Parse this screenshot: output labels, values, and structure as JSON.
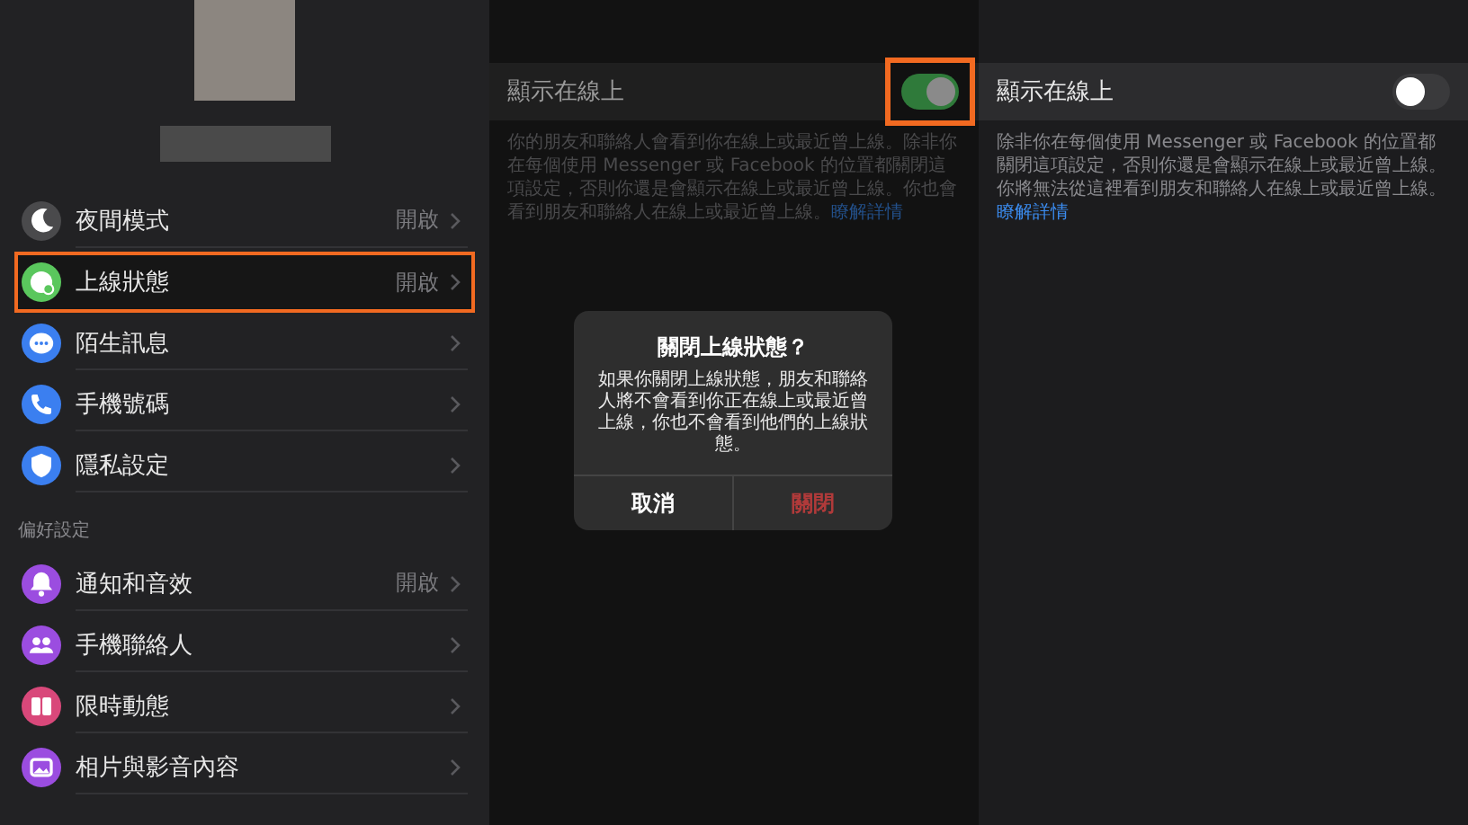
{
  "sidebar": {
    "sections": [
      {
        "items": [
          {
            "kind": "moon",
            "color": "#4a4a4c",
            "label": "夜間模式",
            "value": "開啟",
            "highlighted": false
          },
          {
            "kind": "status",
            "color": "#5ac75d",
            "label": "上線狀態",
            "value": "開啟",
            "highlighted": true
          },
          {
            "kind": "chat",
            "color": "#3b7ff0",
            "label": "陌生訊息",
            "highlighted": false
          },
          {
            "kind": "phone",
            "color": "#3b7ff0",
            "label": "手機號碼",
            "highlighted": false
          },
          {
            "kind": "shield",
            "color": "#3b7ff0",
            "label": "隱私設定",
            "highlighted": false
          }
        ]
      },
      {
        "header": "偏好設定",
        "items": [
          {
            "kind": "bell",
            "color": "#9b4de0",
            "label": "通知和音效",
            "value": "開啟",
            "highlighted": false
          },
          {
            "kind": "people",
            "color": "#9b4de0",
            "label": "手機聯絡人",
            "highlighted": false
          },
          {
            "kind": "story",
            "color": "#d9487a",
            "label": "限時動態",
            "highlighted": false
          },
          {
            "kind": "photo",
            "color": "#9b4de0",
            "label": "相片與影音內容",
            "highlighted": false
          }
        ]
      }
    ]
  },
  "panels": [
    {
      "dimmed": true,
      "setting": {
        "label": "顯示在線上",
        "on": true,
        "highlighted": true
      },
      "description": "你的朋友和聯絡人會看到你在線上或最近曾上線。除非你在每個使用 Messenger 或 Facebook 的位置都關閉這項設定，否則你還是會顯示在線上或最近曾上線。你也會看到朋友和聯絡人在線上或最近曾上線。",
      "link": "瞭解詳情",
      "dialog": {
        "title": "關閉上線狀態？",
        "message": "如果你關閉上線狀態，朋友和聯絡人將不會看到你正在線上或最近曾上線，你也不會看到他們的上線狀態。",
        "buttons": [
          {
            "label": "取消",
            "kind": "cancel"
          },
          {
            "label": "關閉",
            "kind": "destructive"
          }
        ]
      }
    },
    {
      "dimmed": false,
      "setting": {
        "label": "顯示在線上",
        "on": false
      },
      "description": "除非你在每個使用 Messenger 或 Facebook 的位置都關閉這項設定，否則你還是會顯示在線上或最近曾上線。你將無法從這裡看到朋友和聯絡人在線上或最近曾上線。",
      "link": "瞭解詳情"
    }
  ]
}
